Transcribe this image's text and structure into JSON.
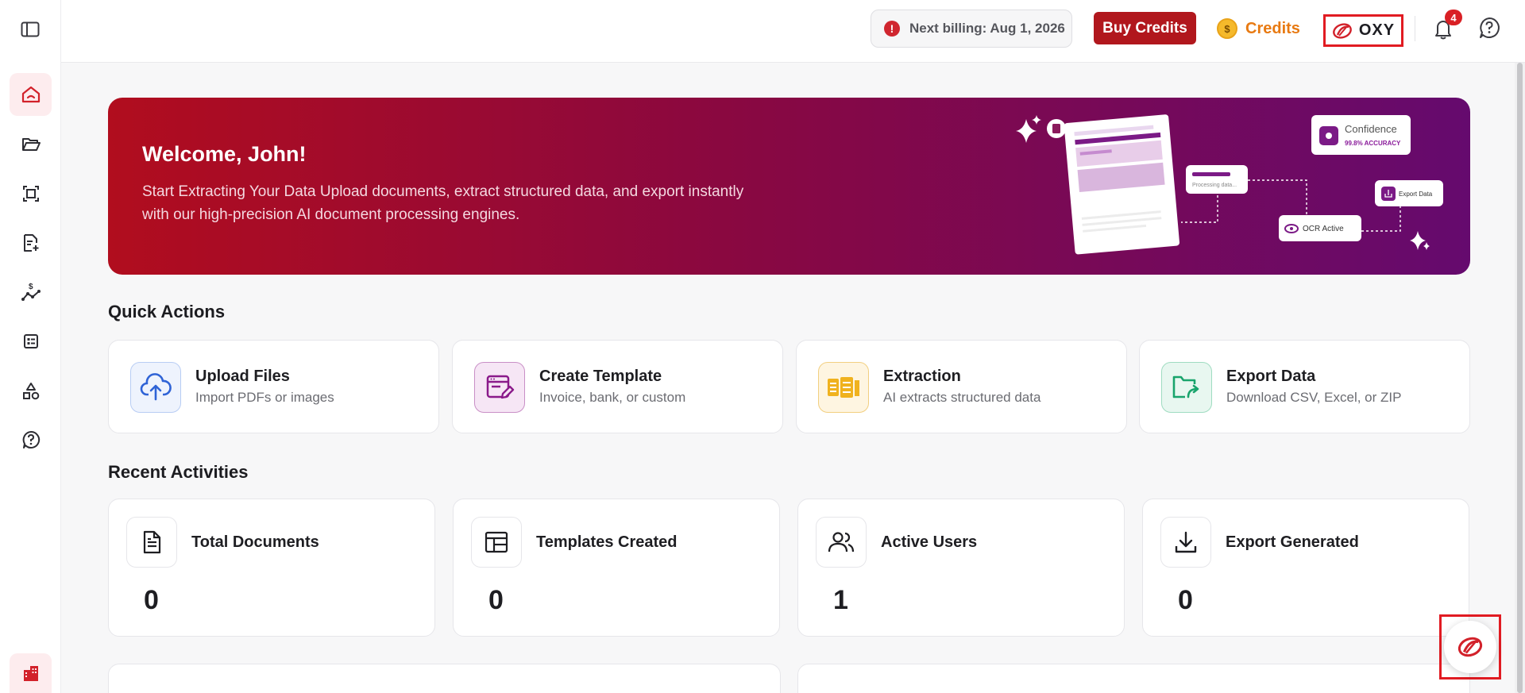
{
  "topbar": {
    "billing_text": "Next billing: Aug 1, 2026",
    "buy_credits_label": "Buy Credits",
    "credits_label": "Credits",
    "org_label": "OXY",
    "notification_count": "4"
  },
  "banner": {
    "title": "Welcome, John!",
    "description": "Start Extracting Your Data Upload documents, extract structured data, and export instantly with our high-precision AI document processing engines.",
    "confidence_label": "Confidence",
    "accuracy_label": "99.8% ACCURACY",
    "processing_label": "Processing data...",
    "export_label": "Export Data",
    "ocr_label": "OCR Active"
  },
  "quick_actions": {
    "title": "Quick Actions",
    "items": [
      {
        "title": "Upload Files",
        "subtitle": "Import PDFs or images",
        "icon": "cloud-upload-icon",
        "color": "#2f63d6"
      },
      {
        "title": "Create Template",
        "subtitle": "Invoice, bank, or custom",
        "icon": "template-edit-icon",
        "color": "#8a1a8a"
      },
      {
        "title": "Extraction",
        "subtitle": "AI extracts structured data",
        "icon": "extraction-icon",
        "color": "#e8a317"
      },
      {
        "title": "Export Data",
        "subtitle": "Download CSV, Excel, or ZIP",
        "icon": "folder-export-icon",
        "color": "#19a46c"
      }
    ]
  },
  "recent": {
    "title": "Recent Activities",
    "items": [
      {
        "title": "Total Documents",
        "value": "0",
        "icon": "document-icon"
      },
      {
        "title": "Templates Created",
        "value": "0",
        "icon": "template-icon"
      },
      {
        "title": "Active Users",
        "value": "1",
        "icon": "users-icon"
      },
      {
        "title": "Export Generated",
        "value": "0",
        "icon": "download-icon"
      }
    ]
  },
  "colors": {
    "brand_red": "#b1171d",
    "accent_orange": "#e87a12",
    "highlight": "#e11b22"
  }
}
